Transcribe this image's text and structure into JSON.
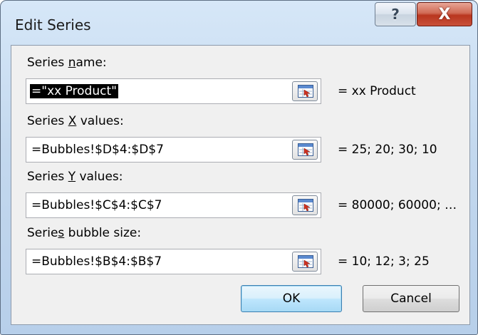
{
  "window": {
    "title": "Edit Series",
    "help_glyph": "?",
    "close_glyph": "X"
  },
  "fields": [
    {
      "label": "Series name:",
      "mnemonic": "n",
      "value": "=\"xx Product\"",
      "result": "= xx Product",
      "selected": true
    },
    {
      "label": "Series X values:",
      "mnemonic": "X",
      "value": "=Bubbles!$D$4:$D$7",
      "result": "= 25; 20; 30; 10",
      "selected": false
    },
    {
      "label": "Series Y values:",
      "mnemonic": "Y",
      "value": "=Bubbles!$C$4:$C$7",
      "result": "= 80000; 60000; …",
      "selected": false
    },
    {
      "label": "Series bubble size:",
      "mnemonic": "s",
      "value": "=Bubbles!$B$4:$B$7",
      "result": "= 10; 12; 3; 25",
      "selected": false
    }
  ],
  "buttons": {
    "ok_label": "OK",
    "cancel_label": "Cancel"
  },
  "icons": {
    "help": "help-icon",
    "close": "close-icon",
    "range_selector": "collapse-dialog-icon"
  },
  "colors": {
    "selection_bg": "#000000",
    "close_red": "#c8503a",
    "frame_blue": "#c3d8ee"
  }
}
